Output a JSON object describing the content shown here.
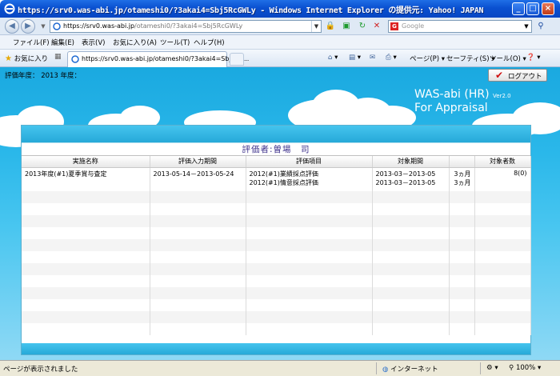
{
  "window": {
    "title": "https://srv0.was-abi.jp/otameshi0/?3akai4=Sbj5RcGWLy - Windows Internet Explorer の提供元: Yahoo! JAPAN"
  },
  "address": {
    "url_host": "https://srv0.was-abi.jp",
    "url_path": "/otameshi0/?3akai4=Sbj5RcGWLy",
    "search_placeholder": "Google"
  },
  "menu": [
    "ファイル(F)",
    "編集(E)",
    "表示(V)",
    "お気に入り(A)",
    "ツール(T)",
    "ヘルプ(H)"
  ],
  "favorites": {
    "label": "お気に入り"
  },
  "tab": {
    "label": "https://srv0.was-abi.jp/otameshi0/?3akai4=Sbj5Rc..."
  },
  "commands": {
    "page": "ページ(P)",
    "safety": "セーフティ(S)",
    "tools": "ツール(O)"
  },
  "page": {
    "eval_year_label": "評価年度：  2013  年度：",
    "logout": "ログアウト",
    "brand_line1": "WAS-abi (HR)",
    "brand_version": "Ver2.0",
    "brand_line2": "For Appraisal",
    "evaluator": "評価者:曽場　司"
  },
  "table": {
    "headers": [
      "実施名称",
      "評価入力期間",
      "評価項目",
      "対象期間",
      "",
      "対象者数"
    ],
    "row": {
      "name": "2013年度(#1)夏季賞与査定",
      "input_period": "2013-05-14－2013-05-24",
      "item1": "2012(#1)業績採点評価",
      "item2": "2012(#1)情意採点評価",
      "period1": "2013-03－2013-05",
      "period2": "2013-03－2013-05",
      "months1": "3ヵ月",
      "months2": "3ヵ月",
      "count": "8(0)"
    }
  },
  "status": {
    "left": "ページが表示されました",
    "zone": "インターネット",
    "zoom": "100%"
  }
}
